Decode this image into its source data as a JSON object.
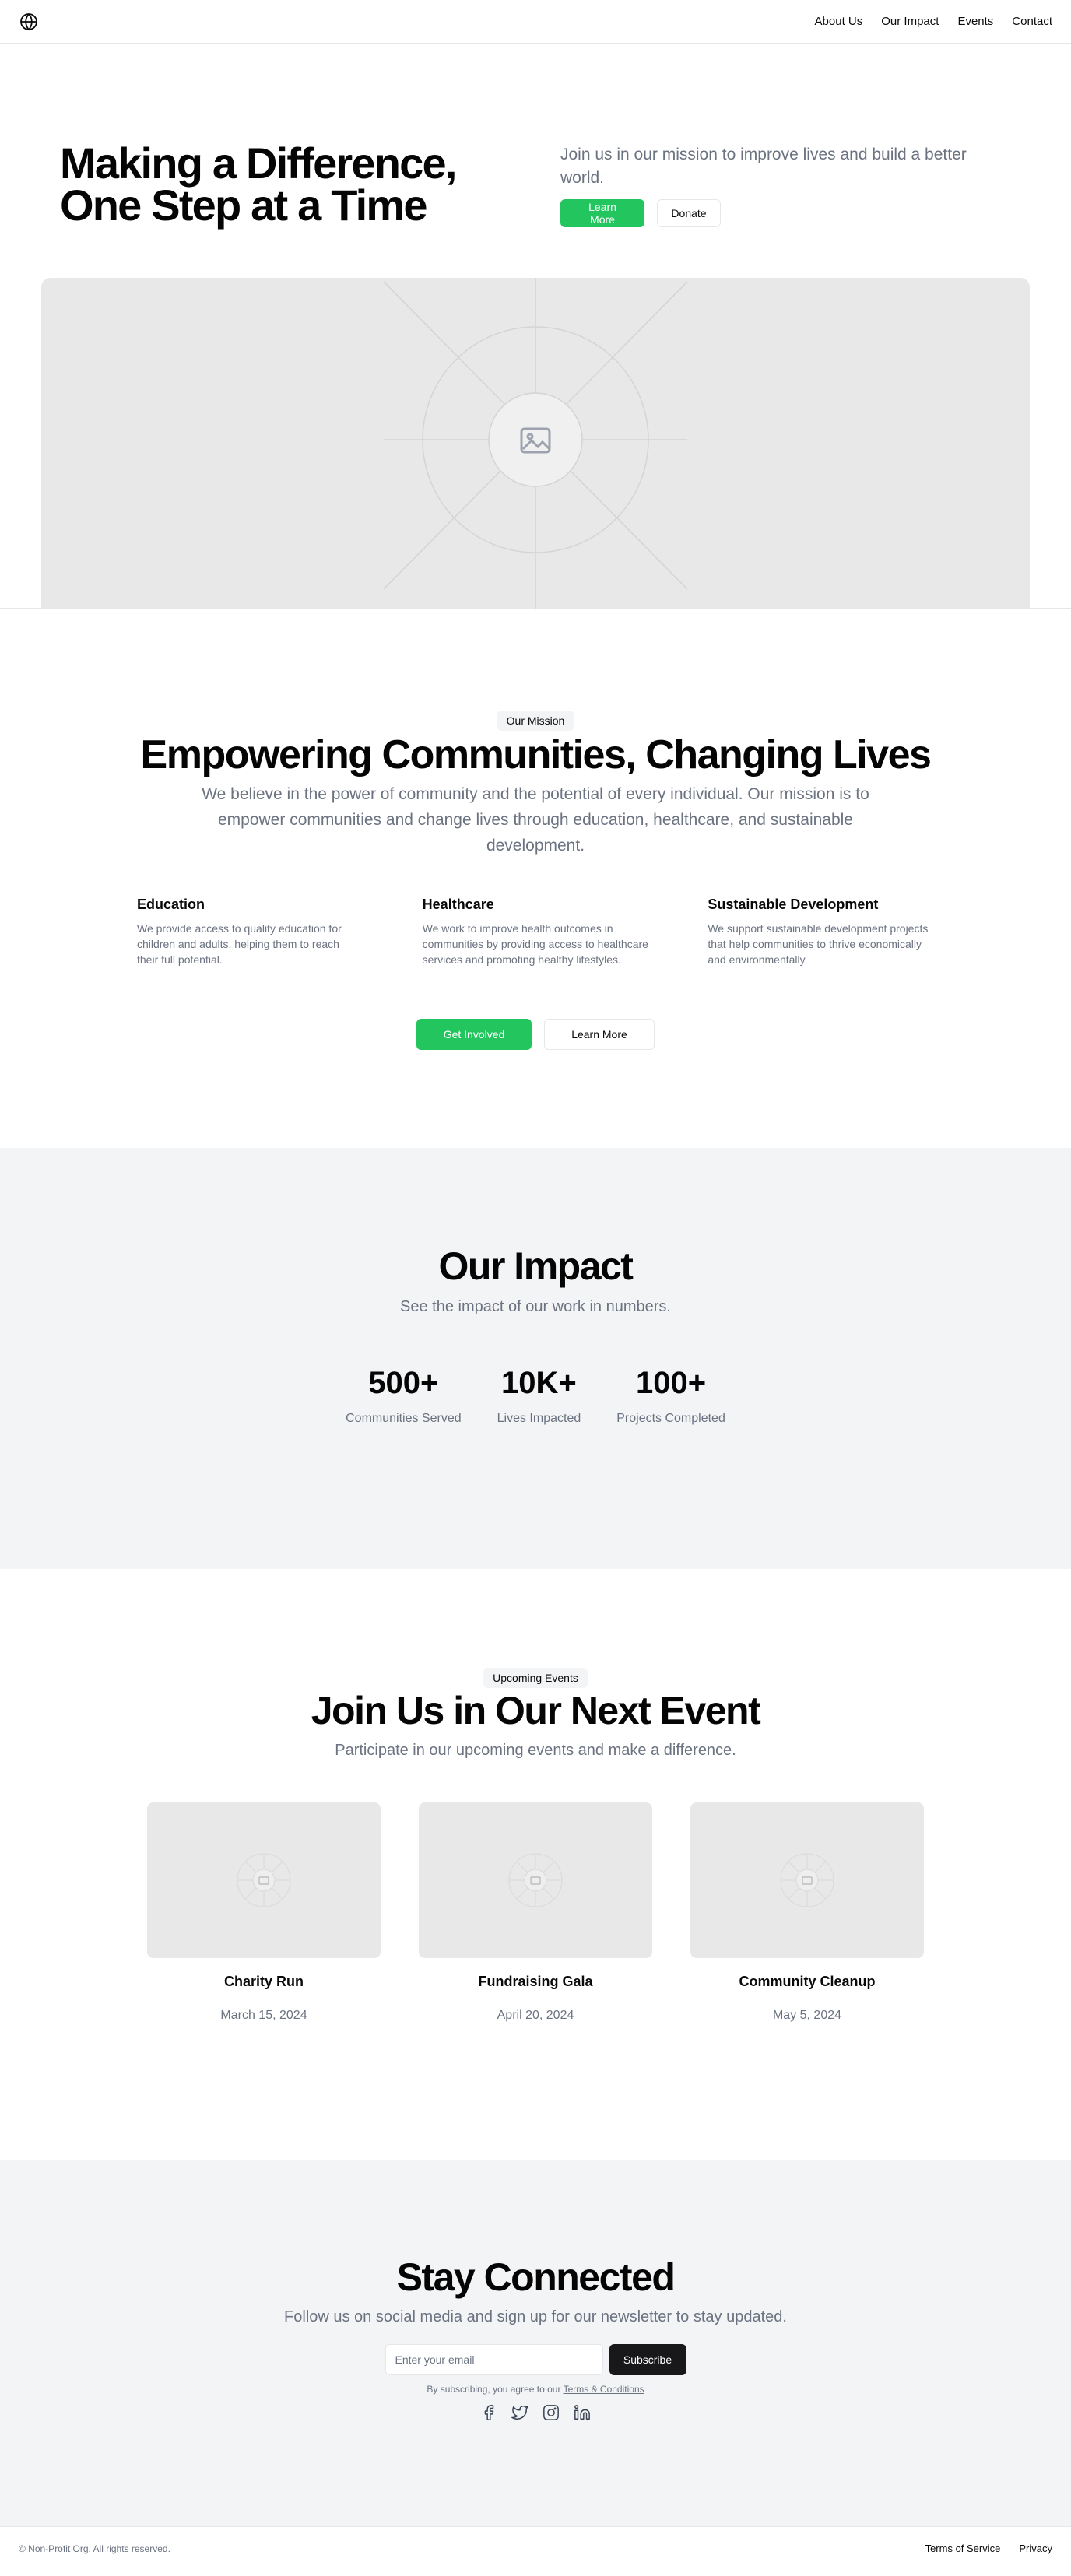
{
  "header": {
    "logo_icon": "globe-icon",
    "nav": [
      {
        "label": "About Us"
      },
      {
        "label": "Our Impact"
      },
      {
        "label": "Events"
      },
      {
        "label": "Contact"
      }
    ]
  },
  "hero": {
    "title": "Making a Difference, One Step at a Time",
    "subtitle": "Join us in our mission to improve lives and build a better world.",
    "primary_button": "Learn More",
    "secondary_button": "Donate",
    "image_icon": "image-placeholder-icon"
  },
  "mission": {
    "badge": "Our Mission",
    "title": "Empowering Communities, Changing Lives",
    "description": "We believe in the power of community and the potential of every individual. Our mission is to empower communities and change lives through education, healthcare, and sustainable development.",
    "features": [
      {
        "title": "Education",
        "text": "We provide access to quality education for children and adults, helping them to reach their full potential."
      },
      {
        "title": "Healthcare",
        "text": "We work to improve health outcomes in communities by providing access to healthcare services and promoting healthy lifestyles."
      },
      {
        "title": "Sustainable Development",
        "text": "We support sustainable development projects that help communities to thrive economically and environmentally."
      }
    ],
    "primary_button": "Get Involved",
    "secondary_button": "Learn More"
  },
  "impact": {
    "title": "Our Impact",
    "subtitle": "See the impact of our work in numbers.",
    "stats": [
      {
        "value": "500+",
        "label": "Communities Served"
      },
      {
        "value": "10K+",
        "label": "Lives Impacted"
      },
      {
        "value": "100+",
        "label": "Projects Completed"
      }
    ]
  },
  "events": {
    "badge": "Upcoming Events",
    "title": "Join Us in Our Next Event",
    "subtitle": "Participate in our upcoming events and make a difference.",
    "items": [
      {
        "name": "Charity Run",
        "date": "March 15, 2024"
      },
      {
        "name": "Fundraising Gala",
        "date": "April 20, 2024"
      },
      {
        "name": "Community Cleanup",
        "date": "May 5, 2024"
      }
    ]
  },
  "connect": {
    "title": "Stay Connected",
    "subtitle": "Follow us on social media and sign up for our newsletter to stay updated.",
    "email_placeholder": "Enter your email",
    "subscribe_button": "Subscribe",
    "terms_prefix": "By subscribing, you agree to our ",
    "terms_link": "Terms & Conditions",
    "socials": [
      "facebook-icon",
      "twitter-icon",
      "instagram-icon",
      "linkedin-icon"
    ]
  },
  "footer": {
    "copyright": "© Non-Profit Org. All rights reserved.",
    "links": [
      {
        "label": "Terms of Service"
      },
      {
        "label": "Privacy"
      }
    ]
  },
  "colors": {
    "accent": "#22c55e",
    "dark_button": "#18181b",
    "muted_text": "#6b7280",
    "section_bg": "#f3f4f6",
    "placeholder_bg": "#e8e8e8"
  }
}
